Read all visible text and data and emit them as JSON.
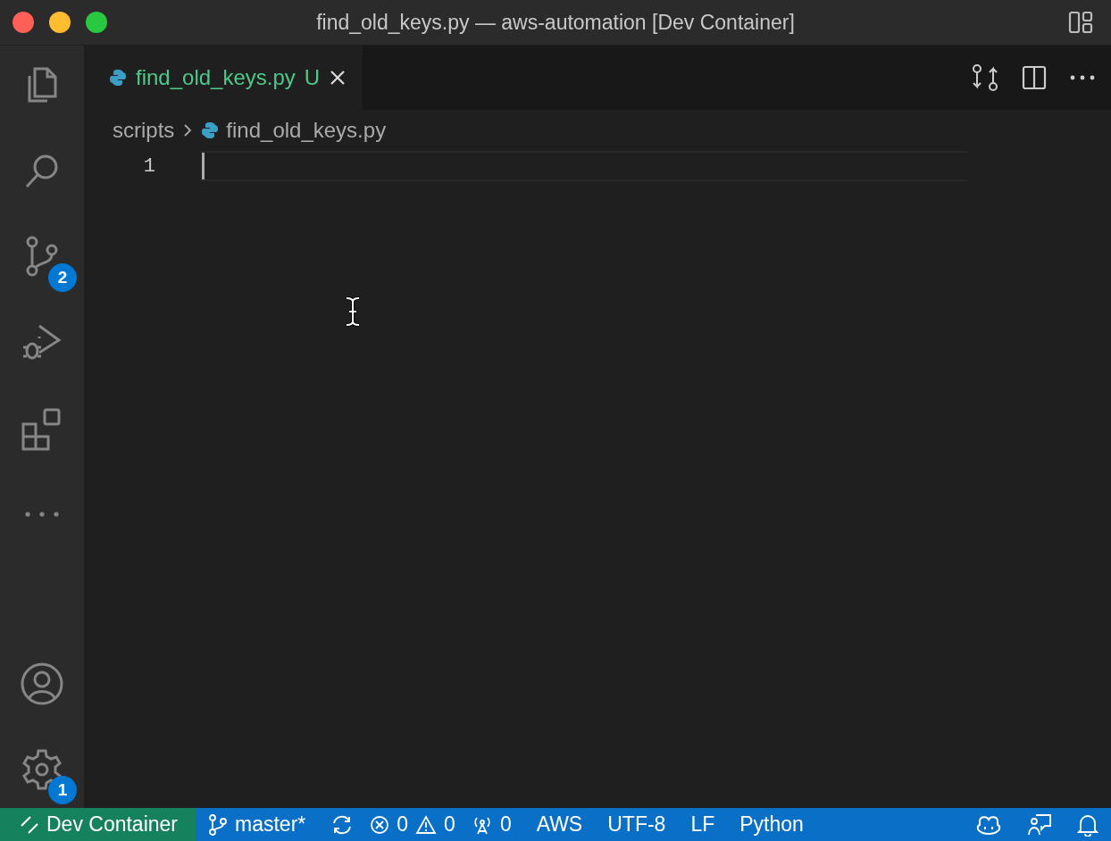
{
  "window": {
    "title": "find_old_keys.py — aws-automation [Dev Container]"
  },
  "activity_bar": {
    "top": [
      {
        "kind": "explorer"
      },
      {
        "kind": "search"
      },
      {
        "kind": "scm",
        "badge": "2"
      },
      {
        "kind": "debug"
      },
      {
        "kind": "extensions"
      },
      {
        "kind": "more"
      }
    ],
    "bottom": [
      {
        "kind": "account"
      },
      {
        "kind": "settings",
        "badge": "1"
      }
    ]
  },
  "tabs": [
    {
      "label": "find_old_keys.py",
      "status": "U",
      "selected": true
    }
  ],
  "breadcrumb": [
    "scripts",
    "find_old_keys.py"
  ],
  "editor": {
    "line_numbers": [
      "1"
    ]
  },
  "status_bar": [
    {
      "kind": "remote",
      "text": "Dev Container"
    },
    {
      "kind": "branch",
      "text": "master*"
    },
    {
      "kind": "sync"
    },
    {
      "kind": "errors",
      "text": "0"
    },
    {
      "kind": "warnings",
      "text": "0"
    },
    {
      "kind": "ports",
      "text": "0"
    },
    {
      "kind": "plain",
      "text": "AWS"
    },
    {
      "kind": "plain",
      "text": "UTF-8"
    },
    {
      "kind": "plain",
      "text": "LF"
    },
    {
      "kind": "plain",
      "text": "Python"
    },
    {
      "kind": "copilot"
    },
    {
      "kind": "feedback"
    },
    {
      "kind": "bell"
    }
  ]
}
